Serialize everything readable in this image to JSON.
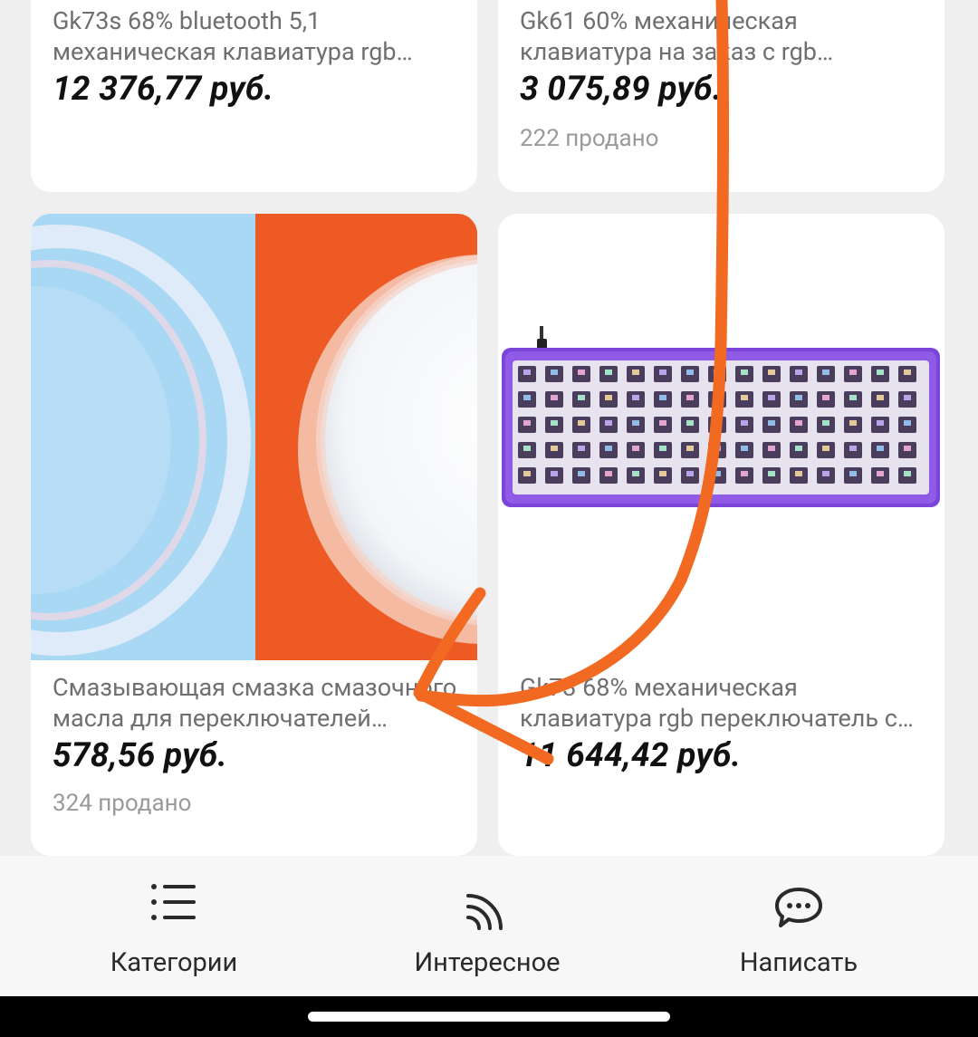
{
  "products": [
    {
      "title": "Gk73s 68% bluetooth 5,1 механическая клавиатура rgb беспроводная",
      "price": "12 376,77 руб.",
      "sold": ""
    },
    {
      "title": "Gk61 60% механическая клавиатура на заказ с rgb подсветкой",
      "price": "3 075,89 руб.",
      "sold": "222 продано"
    },
    {
      "title": "Смазывающая смазка смазочного масла для переключателей клавиатуры",
      "price": "578,56 руб.",
      "sold": "324 продано"
    },
    {
      "title": "Gk73 68% механическая клавиатура rgb переключатель с горячей заменой",
      "price": "11 644,42 руб.",
      "sold": ""
    }
  ],
  "nav": {
    "categories": "Категории",
    "interesting": "Интересное",
    "write": "Написать"
  },
  "colors": {
    "accent_annotation": "#f26a21",
    "keyboard_case": "#7a45d8",
    "background": "#efefef"
  }
}
